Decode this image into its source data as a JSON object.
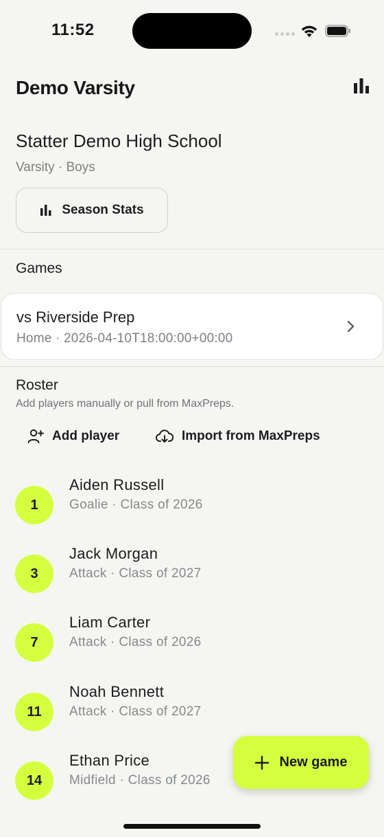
{
  "status_bar": {
    "time": "11:52"
  },
  "header": {
    "title": "Demo Varsity"
  },
  "team": {
    "school": "Statter Demo High School",
    "subtitle": "Varsity · Boys",
    "season_stats_label": "Season Stats"
  },
  "games": {
    "heading": "Games",
    "items": [
      {
        "title": "vs Riverside Prep",
        "subtitle": "Home · 2026-04-10T18:00:00+00:00"
      }
    ]
  },
  "roster": {
    "heading": "Roster",
    "subtitle": "Add players manually or pull from MaxPreps.",
    "add_player_label": "Add player",
    "import_label": "Import from MaxPreps",
    "players": [
      {
        "number": "1",
        "name": "Aiden Russell",
        "info": "Goalie · Class of 2026"
      },
      {
        "number": "3",
        "name": "Jack Morgan",
        "info": "Attack · Class of 2027"
      },
      {
        "number": "7",
        "name": "Liam Carter",
        "info": "Attack · Class of 2026"
      },
      {
        "number": "11",
        "name": "Noah Bennett",
        "info": "Attack · Class of 2027"
      },
      {
        "number": "14",
        "name": "Ethan Price",
        "info": "Midfield · Class of 2026"
      }
    ]
  },
  "fab": {
    "label": "New game"
  },
  "colors": {
    "accent": "#d4ff3f",
    "background": "#f5f6f1"
  }
}
